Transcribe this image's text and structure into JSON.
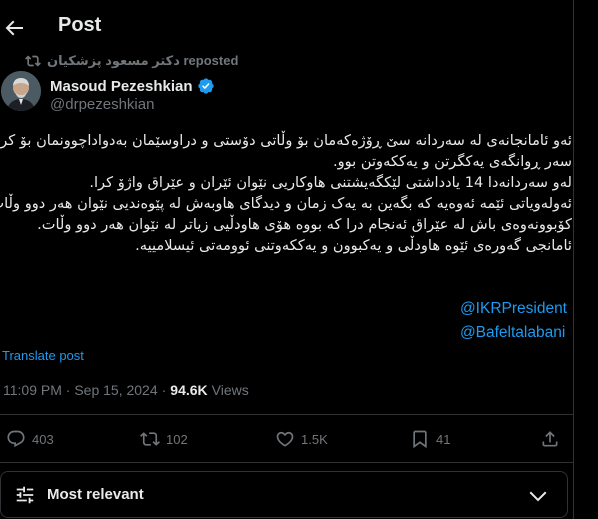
{
  "header": {
    "title": "Post"
  },
  "repost": {
    "text": "دکتر مسعود پزشکیان reposted"
  },
  "author": {
    "name": "Masoud Pezeshkian",
    "handle": "@drpezeshkian"
  },
  "post": {
    "lines": [
      "ئەو ئامانجانەی لە سەردانە سێ ڕۆژەکەمان بۆ وڵاتی دۆستی و دراوسێمان بەدواداچوونمان بۆ کرد لە",
      "سەر ڕوانگەی یەکگرتن و یەککەوتن بوو.",
      "لەو سەردانەدا 14 یادداشتی لێکگەیشتنی هاوکاریی نێوان ئێران و عێراق واژۆ کرا.",
      "ئەولەویاتی ئێمە ئەوەیە کە بگەین بە یەک زمان و دیدگای هاوبەش لە پێوەندیی نێوان هەر دوو وڵات.",
      "کۆبوونەوەی باش لە عێراق ئەنجام درا کە بووە هۆی هاودڵیی زیاتر لە نێوان هەر دوو وڵات.",
      "ئامانجی گەورەی ئێوە هاودڵی و یەکبوون و یەککەوتنی ئوومەتی ئیسلامییە."
    ],
    "mentions": [
      "@IKRPresident",
      "@Bafeltalabani"
    ],
    "translate_label": "Translate post",
    "timestamp": "11:09 PM · Sep 15, 2024",
    "separator": "·",
    "views_count": "94.6K",
    "views_label": "Views"
  },
  "actions": {
    "replies": "403",
    "reposts": "102",
    "likes": "1.5K",
    "bookmarks": "41"
  },
  "sort": {
    "label": "Most relevant"
  },
  "colors": {
    "accent": "#1d9bf0",
    "muted": "#71767b",
    "text": "#e7e9ea",
    "border": "#2f3336"
  }
}
